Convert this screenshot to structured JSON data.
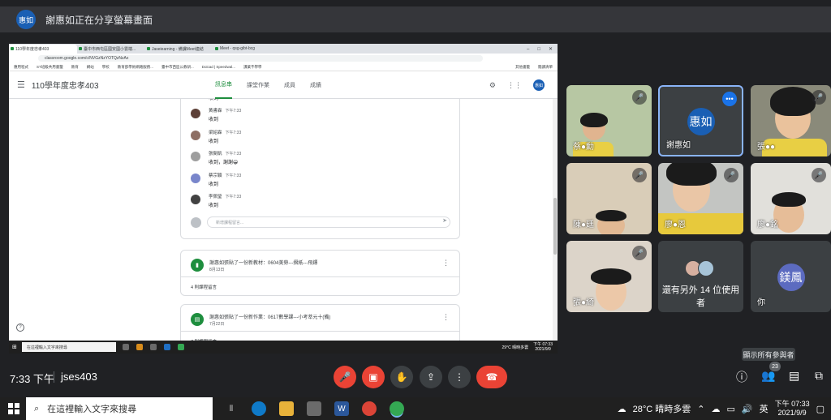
{
  "share_banner": {
    "avatar": "惠如",
    "text": "謝惠如正在分享螢幕畫面"
  },
  "browser": {
    "tabs": [
      "110學年度忠孝403",
      "臺中市西屯區國安國小雲端...",
      "Jaseiearning - 備課Meet連結",
      "Meet - qsg-gibt-bcg"
    ],
    "url": "classroom.google.com/c/NVGzNzYOTQzNzAx",
    "bookmarks": [
      "應用程式",
      "ST班級共用書籤",
      "教育",
      "網站",
      "學校",
      "教育部學術網路服務...",
      "臺中市西區公教研...",
      "Doicad | Speedwal...",
      "課業不學學",
      "其他書籤",
      "閱讀清單"
    ]
  },
  "classroom": {
    "title": "110學年度忠孝403",
    "tabs": [
      "訊息串",
      "課堂作業",
      "成員",
      "成績"
    ],
    "avatar": "惠如",
    "first_body": "收到",
    "comments": [
      {
        "name": "黃書霖",
        "time": "下午7:33",
        "body": "收到"
      },
      {
        "name": "梁紹霖",
        "time": "下午7:33",
        "body": "收到"
      },
      {
        "name": "張閔凱",
        "time": "下午7:33",
        "body": "收到，謝謝😀"
      },
      {
        "name": "蔡宗穎",
        "time": "下午7:33",
        "body": "收到"
      },
      {
        "name": "李佩瑩",
        "time": "下午7:33",
        "body": "收到"
      }
    ],
    "reply_placeholder": "新增課程留言...",
    "posts": [
      {
        "title": "謝惠如張貼了一份新教材：0604美勞---摺紙---飛鏢",
        "date": "8月13日",
        "footer": "4 則課程留言"
      },
      {
        "title": "謝惠如張貼了一份新作業：0617數學課---小考萃元十(備)",
        "date": "7月22日",
        "footer": "7 則課程留言"
      }
    ]
  },
  "inner_taskbar": {
    "search": "在這裡輸入文字來搜尋",
    "weather": "29°C 晴時多雲",
    "time": "下午 07:33",
    "date": "2021/9/9"
  },
  "participants": [
    {
      "name": "蔡●勳",
      "kind": "video"
    },
    {
      "name": "謝惠如",
      "kind": "avatar",
      "avatar": "惠如",
      "color": "#1a5fb4"
    },
    {
      "name": "張●●",
      "kind": "video"
    },
    {
      "name": "陳●廷",
      "kind": "video"
    },
    {
      "name": "廖●恩",
      "kind": "video"
    },
    {
      "name": "廖●銘",
      "kind": "video"
    },
    {
      "name": "張●綺",
      "kind": "video"
    },
    {
      "name": "還有另外 14 位使用者",
      "kind": "others"
    },
    {
      "name": "你",
      "kind": "avatar",
      "avatar": "鎂鳳",
      "color": "#5c6bc0"
    }
  ],
  "meeting": {
    "time": "7:33 下午",
    "code": "jses403",
    "tooltip": "顯示所有參與者",
    "people_count": "23"
  },
  "taskbar": {
    "search": "在這裡輸入文字來搜尋",
    "weather": "28°C 晴時多雲",
    "ime": "英",
    "time": "下午 07:33",
    "date": "2021/9/9"
  },
  "colors": {
    "accent": "#1e8e3e",
    "end_call": "#ea4335",
    "meet_bg": "#202124"
  }
}
